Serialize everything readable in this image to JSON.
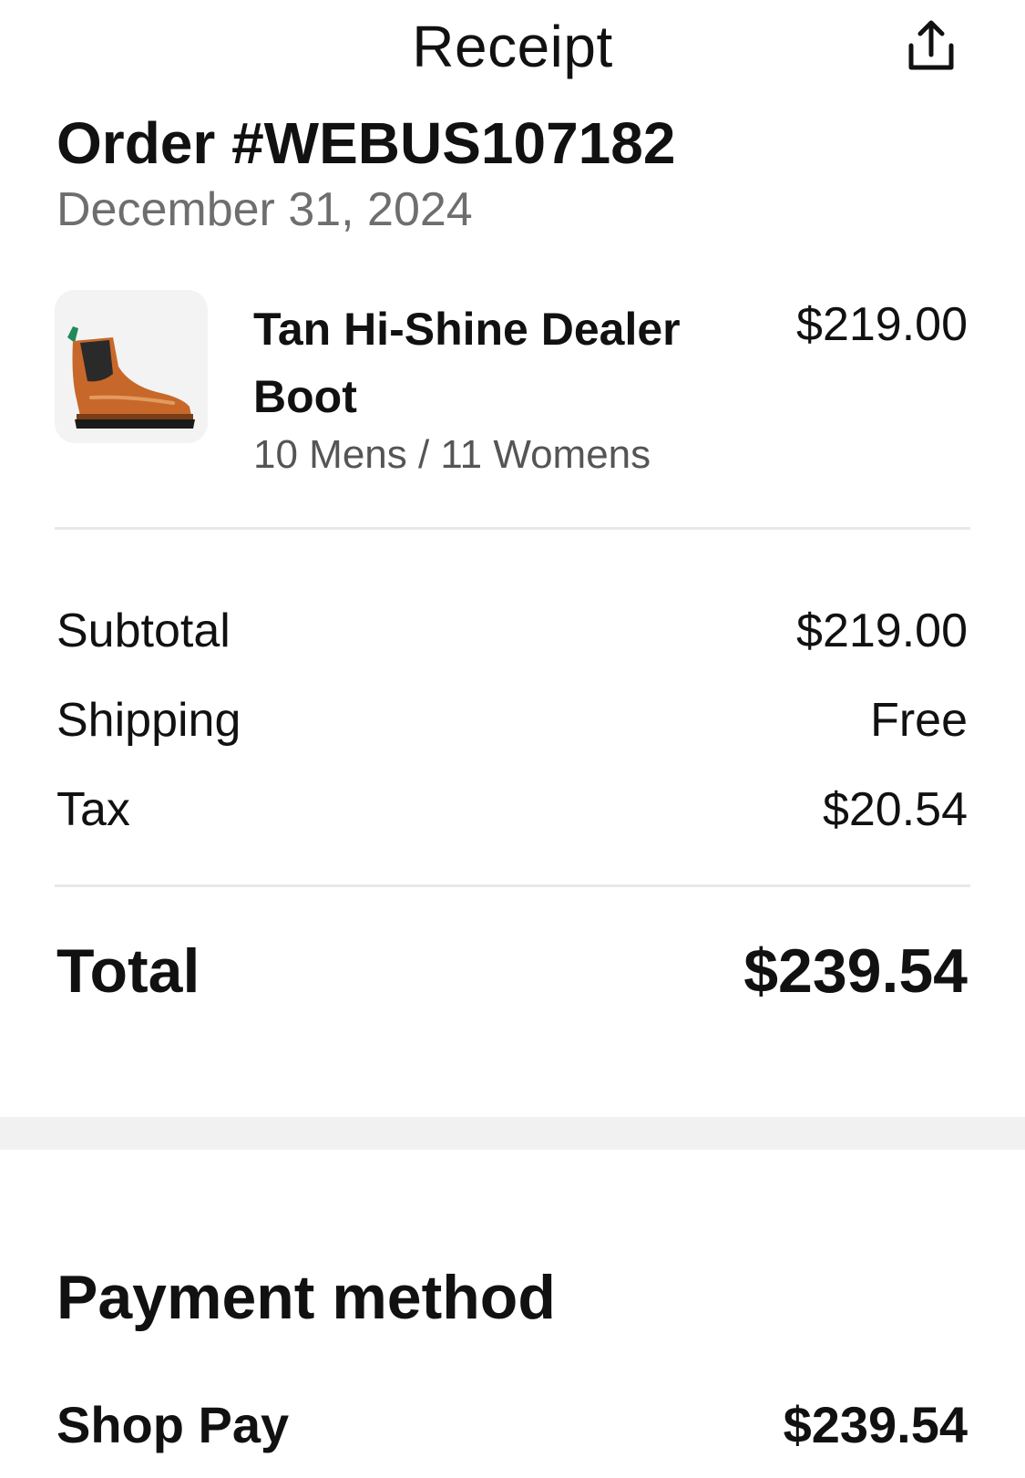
{
  "header": {
    "title": "Receipt",
    "share_icon": "share-upload-icon"
  },
  "order": {
    "number": "Order #WEBUS107182",
    "date": "December 31, 2024"
  },
  "item": {
    "name": "Tan Hi-Shine Dealer Boot",
    "variant": "10 Mens / 11 Womens",
    "price": "$219.00",
    "image_icon": "boot-product-image"
  },
  "summary": {
    "subtotal_label": "Subtotal",
    "subtotal_value": "$219.00",
    "shipping_label": "Shipping",
    "shipping_value": "Free",
    "tax_label": "Tax",
    "tax_value": "$20.54",
    "total_label": "Total",
    "total_value": "$239.54"
  },
  "payment": {
    "heading": "Payment method",
    "method": "Shop Pay",
    "amount": "$239.54"
  },
  "colors": {
    "text": "#111111",
    "muted": "#6e6e6e",
    "divider": "#e8e8e8",
    "band": "#f1f1f1",
    "boot_leather": "#c7682a"
  }
}
